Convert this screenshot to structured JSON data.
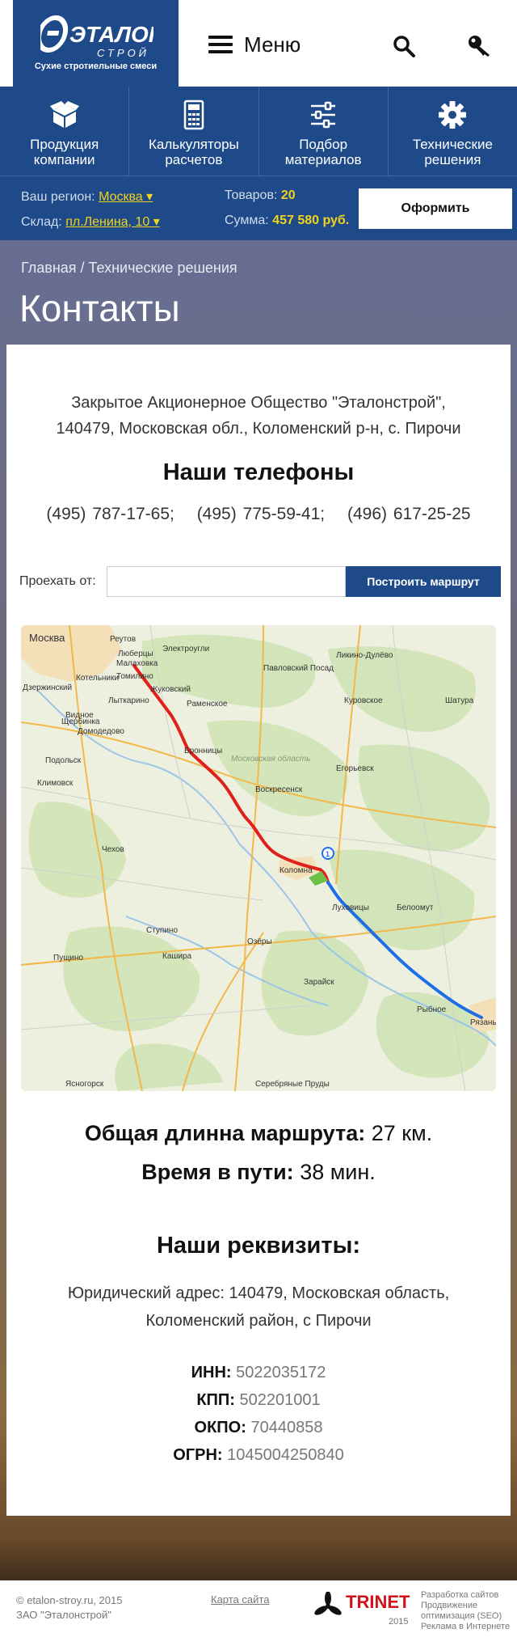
{
  "header": {
    "logo_text": "ЭТАЛОН",
    "logo_sub_text": "СТРОЙ",
    "logo_tagline": "Сухие стротиельные смеси",
    "menu_label": "Меню",
    "icons": [
      "search-icon",
      "key-icon"
    ]
  },
  "nav": [
    {
      "label": "Продукция компании",
      "icon": "box-icon"
    },
    {
      "label": "Калькуляторы расчетов",
      "icon": "calculator-icon"
    },
    {
      "label": "Подбор материалов",
      "icon": "sliders-icon"
    },
    {
      "label": "Технические решения",
      "icon": "gear-icon"
    }
  ],
  "infobar": {
    "region_label": "Ваш регион:",
    "region_value": "Москва ▾",
    "warehouse_label": "Склад:",
    "warehouse_value": "пл.Ленина, 10 ▾",
    "goods_label": "Товаров:",
    "goods_value": "20",
    "sum_label": "Сумма:",
    "sum_value": "457 580 руб.",
    "checkout_label": "Оформить"
  },
  "breadcrumb": "Главная / Технические решения",
  "page_title": "Контакты",
  "contacts": {
    "address_line1": "Закрытое Акционерное Общество \"Эталонстрой\",",
    "address_line2": "140479, Московская обл., Коломенский р-н, с. Пирочи",
    "phones_title": "Наши телефоны",
    "phones": [
      "(495) 787-17-65;",
      "(495) 775-59-41;",
      "(496) 617-25-25"
    ]
  },
  "route": {
    "from_label": "Проехать от:",
    "input_value": "",
    "input_placeholder": "",
    "button_label": "Построить маршрут"
  },
  "map": {
    "labels": [
      "Москва",
      "Реутов",
      "Люберцы",
      "Малаховка",
      "Котельники",
      "Томилино",
      "Дзержинский",
      "Жуковский",
      "Электроугли",
      "Ликино-Дулёво",
      "Павловский Посад",
      "Куровское",
      "Шатура",
      "Раменское",
      "Лыткарино",
      "Видное",
      "Бронницы",
      "Домодедово",
      "Подольск",
      "Климовск",
      "Воскресенск",
      "Егорьевск",
      "Московская область",
      "Коломна",
      "Луховицы",
      "Белоомут",
      "Ступино",
      "Кашира",
      "Озёры",
      "Зарайск",
      "Рыбное",
      "Рязань",
      "Пущино",
      "Серебряные Пруды",
      "Ясногорск",
      "Чехов",
      "Щербинка"
    ],
    "route_colors": [
      "#e0201a",
      "#1e6ee8"
    ]
  },
  "route_stats": {
    "length_label": "Общая длинна маршрута:",
    "length_value": "27 км.",
    "time_label": "Время в пути:",
    "time_value": "38 мин."
  },
  "requisites": {
    "title": "Наши реквизиты:",
    "legal_line1": "Юридический адрес: 140479, Московская область,",
    "legal_line2": "Коломенский район, с Пирочи",
    "items": [
      {
        "key": "ИНН:",
        "value": "5022035172"
      },
      {
        "key": "КПП:",
        "value": "502201001"
      },
      {
        "key": "ОКПО:",
        "value": "70440858"
      },
      {
        "key": "ОГРН:",
        "value": "1045004250840"
      }
    ]
  },
  "footer": {
    "copy_line1": "© etalon-stroy.ru, 2015",
    "copy_line2": "ЗАО \"Эталонстрой\"",
    "sitemap": "Карта сайта",
    "trinet_name": "TRINET",
    "trinet_year": "2015",
    "services": [
      "Разработка сайтов",
      "Продвижение",
      "оптимизация (SEO)",
      "Реклама в Интернете"
    ]
  },
  "colors": {
    "brand": "#1e4a8a",
    "accent": "#f2d21c",
    "route_red": "#e0201a",
    "route_blue": "#1e6ee8"
  }
}
